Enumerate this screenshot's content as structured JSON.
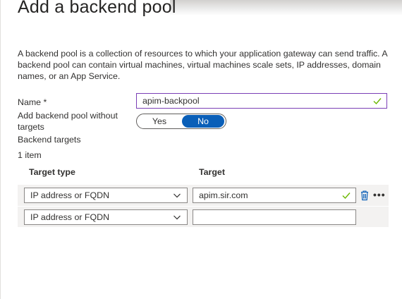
{
  "page": {
    "title": "Add a backend pool",
    "description": "A backend pool is a collection of resources to which your application gateway can send traffic. A backend pool can contain virtual machines, virtual machines scale sets, IP addresses, domain names, or an App Service."
  },
  "form": {
    "name_label": "Name *",
    "name_value": "apim-backpool",
    "without_targets_label": "Add backend pool without targets",
    "toggle": {
      "yes_label": "Yes",
      "no_label": "No",
      "selected": "No"
    },
    "backend_targets_label": "Backend targets",
    "item_count": "1 item"
  },
  "table": {
    "headers": {
      "target_type": "Target type",
      "target": "Target"
    },
    "rows": [
      {
        "target_type": "IP address or FQDN",
        "target": "apim.sir.com"
      },
      {
        "target_type": "IP address or FQDN",
        "target": ""
      }
    ]
  },
  "colors": {
    "accent": "#0a5fb8",
    "valid_check": "#6bb700",
    "focused_border": "#7b3fb6"
  },
  "icons": [
    "checkmark-icon",
    "chevron-down-icon",
    "trash-icon",
    "more-icon"
  ]
}
